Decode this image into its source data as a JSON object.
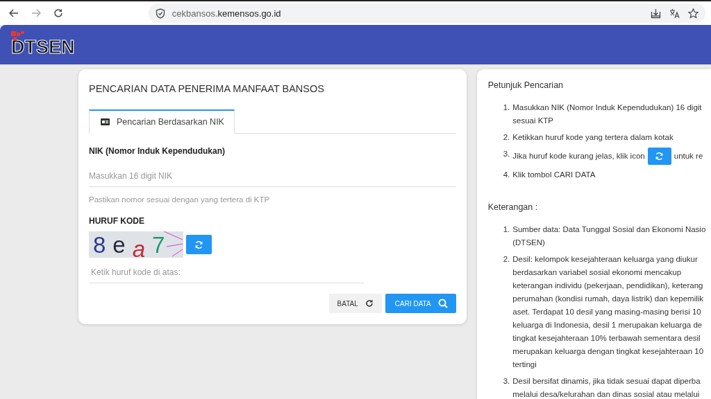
{
  "browser": {
    "url_host": "cekbansos.",
    "url_domain": "kemensos.go.id"
  },
  "header": {
    "logo_text": "DTSEN"
  },
  "search_card": {
    "title": "PENCARIAN DATA PENERIMA MANFAAT BANSOS",
    "tabs": [
      {
        "label": "Pencarian Berdasarkan NIK",
        "selected": true
      }
    ],
    "nik": {
      "label": "NIK (Nomor Induk Kependudukan)",
      "placeholder": "Masukkan 16 digit NIK",
      "hint": "Pastikan nomor sesuai dengan yang tertera di KTP"
    },
    "code": {
      "label": "HURUF KODE",
      "captcha": [
        {
          "text": "8",
          "color": "#2e3a8c"
        },
        {
          "text": "e",
          "color": "#2a2a3a"
        },
        {
          "text": "a",
          "color": "#c0303a"
        },
        {
          "text": "7",
          "color": "#1f9a72"
        }
      ],
      "placeholder": "Ketik huruf kode di atas:"
    },
    "buttons": [
      {
        "label": "BATAL",
        "kind": "reset"
      },
      {
        "label": "CARI DATA",
        "kind": "search"
      }
    ]
  },
  "info_card": {
    "title": "Petunjuk Pencarian",
    "steps": [
      {
        "number": "1.",
        "lines": [
          "Masukkan NIK (Nomor Induk Kependudukan) 16 digit",
          "sesuai KTP"
        ]
      },
      {
        "number": "2.",
        "lines": [
          "Ketikkan huruf kode yang tertera dalam kotak"
        ]
      },
      {
        "number": "3.",
        "lines": [
          "Jika huruf kode kurang jelas, klik icon"
        ],
        "after_icon": "untuk re"
      },
      {
        "number": "4.",
        "lines": [
          "Klik tombol CARI DATA"
        ]
      }
    ],
    "notes_title": "Keterangan :",
    "notes": [
      {
        "number": "1.",
        "lines": [
          "Sumber data: Data Tunggal Sosial dan Ekonomi Nasio",
          "(DTSEN)"
        ]
      },
      {
        "number": "2.",
        "lines": [
          "Desil: kelompok kesejahteraan keluarga yang diukur",
          "berdasarkan variabel sosial ekonomi mencakup",
          "keterangan individu (pekerjaan, pendidikan), keterang",
          "perumahan (kondisi rumah, daya listrik) dan kepemilik",
          "aset. Terdapat 10 desil yang masing-masing berisi 10",
          "keluarga di Indonesia, desil 1 merupakan keluarga de",
          "tingkat kesejahteraan 10% terbawah sementara desil",
          "merupakan keluarga dengan tingkat kesejahteraan 10",
          "tertingi"
        ]
      },
      {
        "number": "3.",
        "lines": [
          "Desil bersifat dinamis, jika tidak sesuai dapat diperba",
          "melalui desa/kelurahan dan dinas sosial atau melalui"
        ]
      }
    ]
  }
}
